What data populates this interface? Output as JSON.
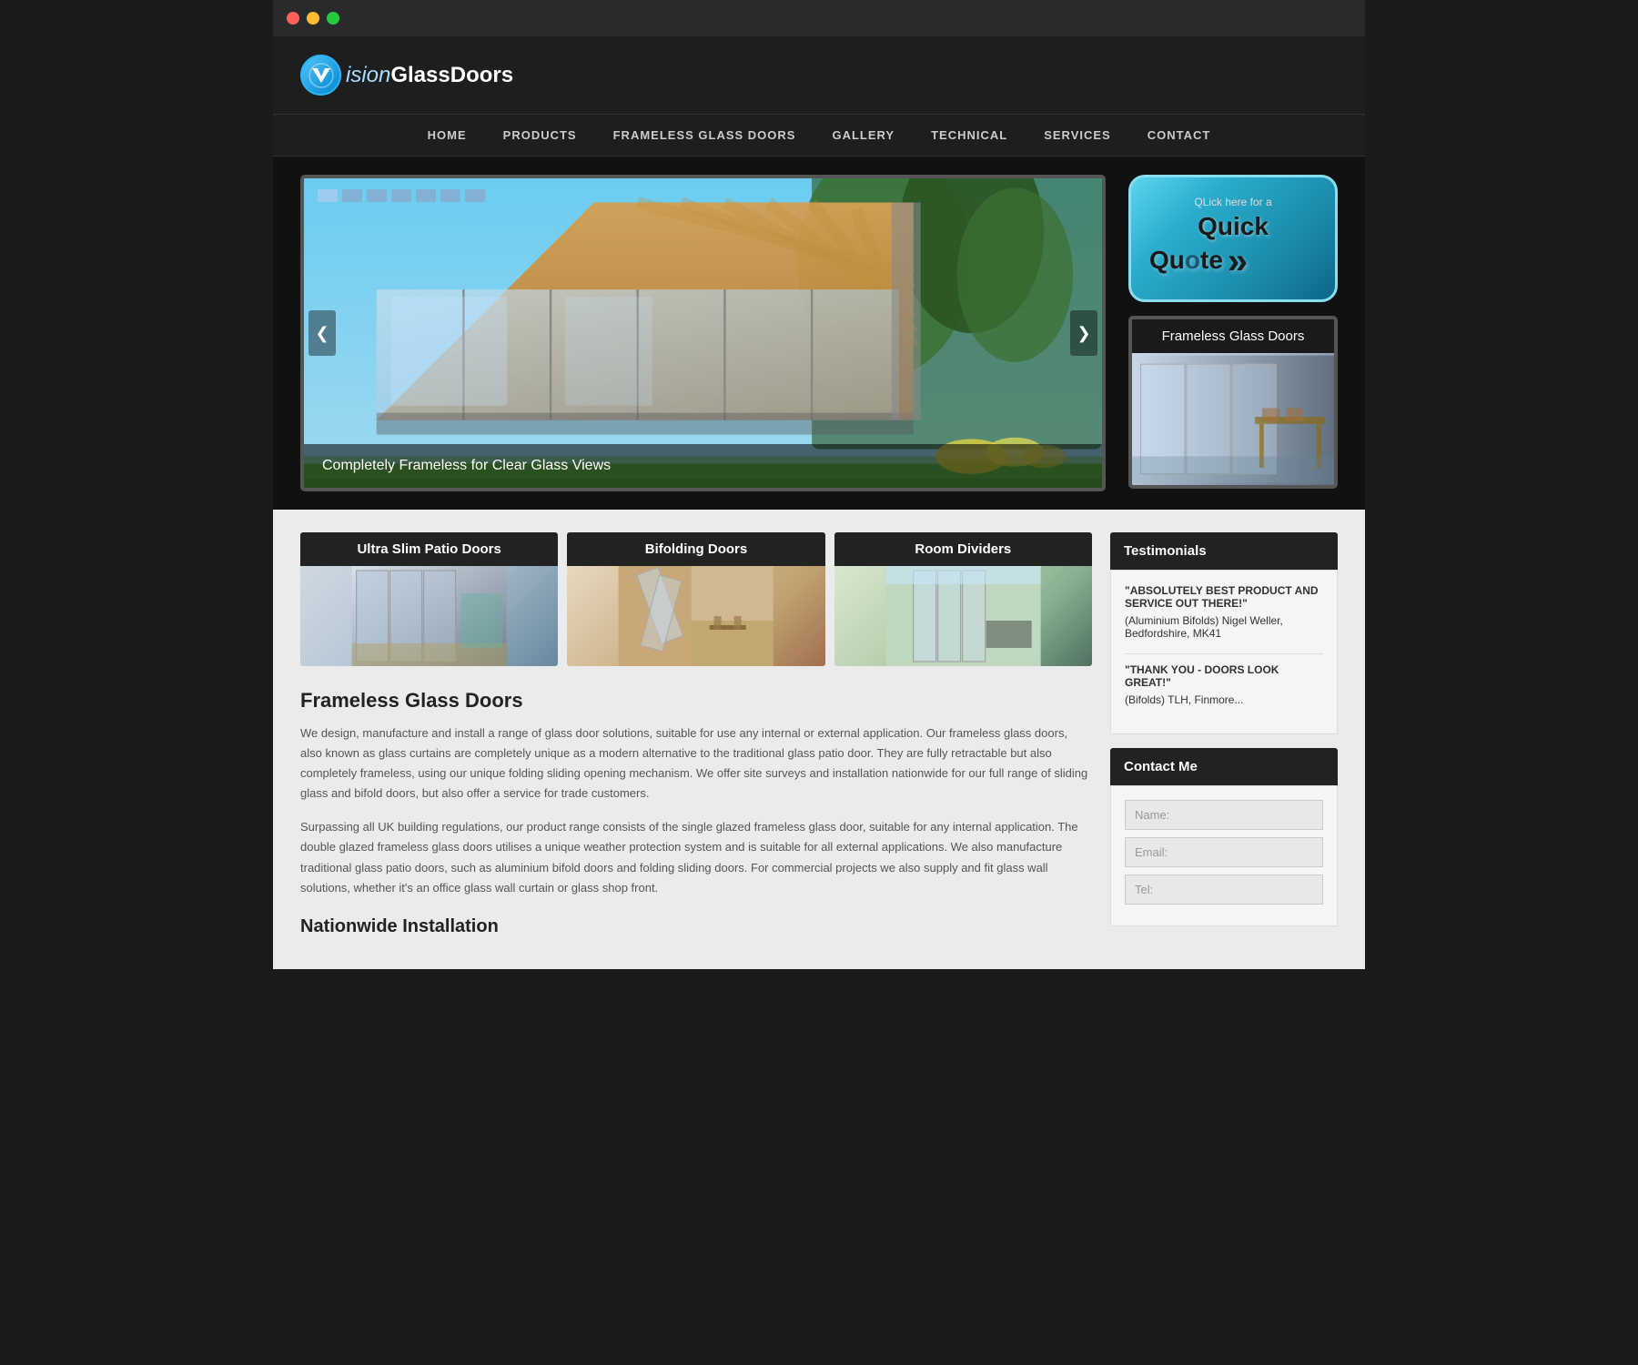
{
  "titlebar": {
    "buttons": [
      "close",
      "minimize",
      "maximize"
    ]
  },
  "header": {
    "logo_letter": "V",
    "logo_text_italic": "ision",
    "logo_text_bold": "GlassDoors"
  },
  "nav": {
    "items": [
      {
        "label": "HOME",
        "href": "#"
      },
      {
        "label": "PRODUCTS",
        "href": "#"
      },
      {
        "label": "FRAMELESS GLASS DOORS",
        "href": "#"
      },
      {
        "label": "GALLERY",
        "href": "#"
      },
      {
        "label": "TECHNICAL",
        "href": "#"
      },
      {
        "label": "SERVICES",
        "href": "#"
      },
      {
        "label": "CONTACT",
        "href": "#"
      }
    ]
  },
  "hero": {
    "slider": {
      "caption": "Completely Frameless for Clear Glass Views",
      "dots_count": 7,
      "arrow_left": "❮",
      "arrow_right": "❯"
    },
    "quick_quote": {
      "small_text": "QLick here for a",
      "large_text": "Quick\nQuote",
      "arrows": "»"
    },
    "frameless_panel": {
      "title": "Frameless Glass Doors"
    }
  },
  "products": {
    "cards": [
      {
        "title": "Ultra Slim Patio Doors"
      },
      {
        "title": "Bifolding Doors"
      },
      {
        "title": "Room Dividers"
      }
    ]
  },
  "content": {
    "section1_title": "Frameless Glass Doors",
    "section1_para1": "We design, manufacture and install a range of glass door solutions, suitable for use any internal or external application. Our frameless glass doors, also known as glass curtains are completely unique as a modern alternative to the traditional glass patio door. They are fully retractable but also completely frameless, using our unique folding sliding opening mechanism. We offer site surveys and installation nationwide for our full range of sliding glass and bifold doors, but also offer a service for trade customers.",
    "section1_para2": "Surpassing all UK building regulations, our product range consists of the single glazed frameless glass door, suitable for any internal application. The double glazed frameless glass doors utilises a unique weather protection system and is suitable for all external applications. We also manufacture traditional glass patio doors, such as aluminium bifold doors and folding sliding doors. For commercial projects we also supply and fit glass wall solutions, whether it's an office glass wall curtain or glass shop front.",
    "section2_title": "Nationwide Installation"
  },
  "testimonials": {
    "section_title": "Testimonials",
    "items": [
      {
        "quote": "\"ABSOLUTELY BEST PRODUCT AND SERVICE OUT THERE!\"",
        "author": "(Aluminium Bifolds) Nigel Weller, Bedfordshire, MK41"
      },
      {
        "quote": "\"THANK YOU - DOORS LOOK GREAT!\"",
        "author": "(Bifolds) TLH, Finmore..."
      }
    ]
  },
  "contact_form": {
    "section_title": "Contact Me",
    "fields": [
      {
        "placeholder": "Name:",
        "type": "text",
        "name": "name"
      },
      {
        "placeholder": "Email:",
        "type": "email",
        "name": "email"
      },
      {
        "placeholder": "Tel:",
        "type": "tel",
        "name": "tel"
      }
    ]
  }
}
